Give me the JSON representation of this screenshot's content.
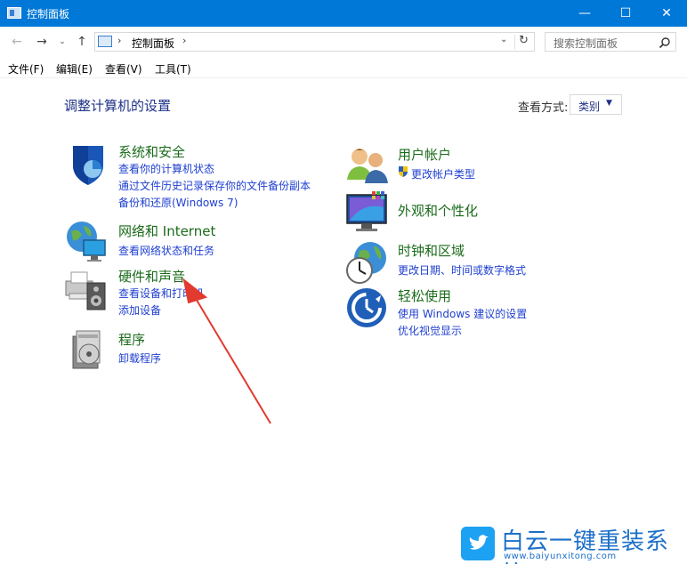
{
  "window": {
    "title": "控制面板",
    "min_glyph": "—",
    "max_glyph": "☐",
    "close_glyph": "✕"
  },
  "navbar": {
    "back_glyph": "←",
    "forward_glyph": "→",
    "recent_glyph": "⌄",
    "up_glyph": "↑",
    "breadcrumb": "控制面板",
    "sep_glyph": "›",
    "dropdown_glyph": "⌄",
    "refresh_glyph": "↻",
    "search_placeholder": "搜索控制面板"
  },
  "menu": [
    "文件(F)",
    "编辑(E)",
    "查看(V)",
    "工具(T)"
  ],
  "content": {
    "title": "调整计算机的设置",
    "view_label": "查看方式:",
    "view_value": "类别",
    "view_arrow": "▼"
  },
  "categories": {
    "security": {
      "title": "系统和安全",
      "links": [
        "查看你的计算机状态",
        "通过文件历史记录保存你的文件备份副本",
        "备份和还原(Windows 7)"
      ]
    },
    "network": {
      "title": "网络和 Internet",
      "links": [
        "查看网络状态和任务"
      ]
    },
    "hardware": {
      "title": "硬件和声音",
      "links": [
        "查看设备和打印机",
        "添加设备"
      ]
    },
    "programs": {
      "title": "程序",
      "links": [
        "卸载程序"
      ]
    },
    "accounts": {
      "title": "用户帐户",
      "links": [
        "更改帐户类型"
      ]
    },
    "appearance": {
      "title": "外观和个性化",
      "links": []
    },
    "clock": {
      "title": "时钟和区域",
      "links": [
        "更改日期、时间或数字格式"
      ]
    },
    "ease": {
      "title": "轻松使用",
      "links": [
        "使用 Windows 建议的设置",
        "优化视觉显示"
      ]
    }
  },
  "watermark": {
    "brand": "白云一键重装系统",
    "url": "www.baiyunxitong.com"
  },
  "colors": {
    "titlebar": "#0078d7",
    "category_title": "#1a6b1a",
    "link": "#1f3fd1",
    "heading": "#1e3287",
    "annotation_arrow": "#e23a2e"
  }
}
